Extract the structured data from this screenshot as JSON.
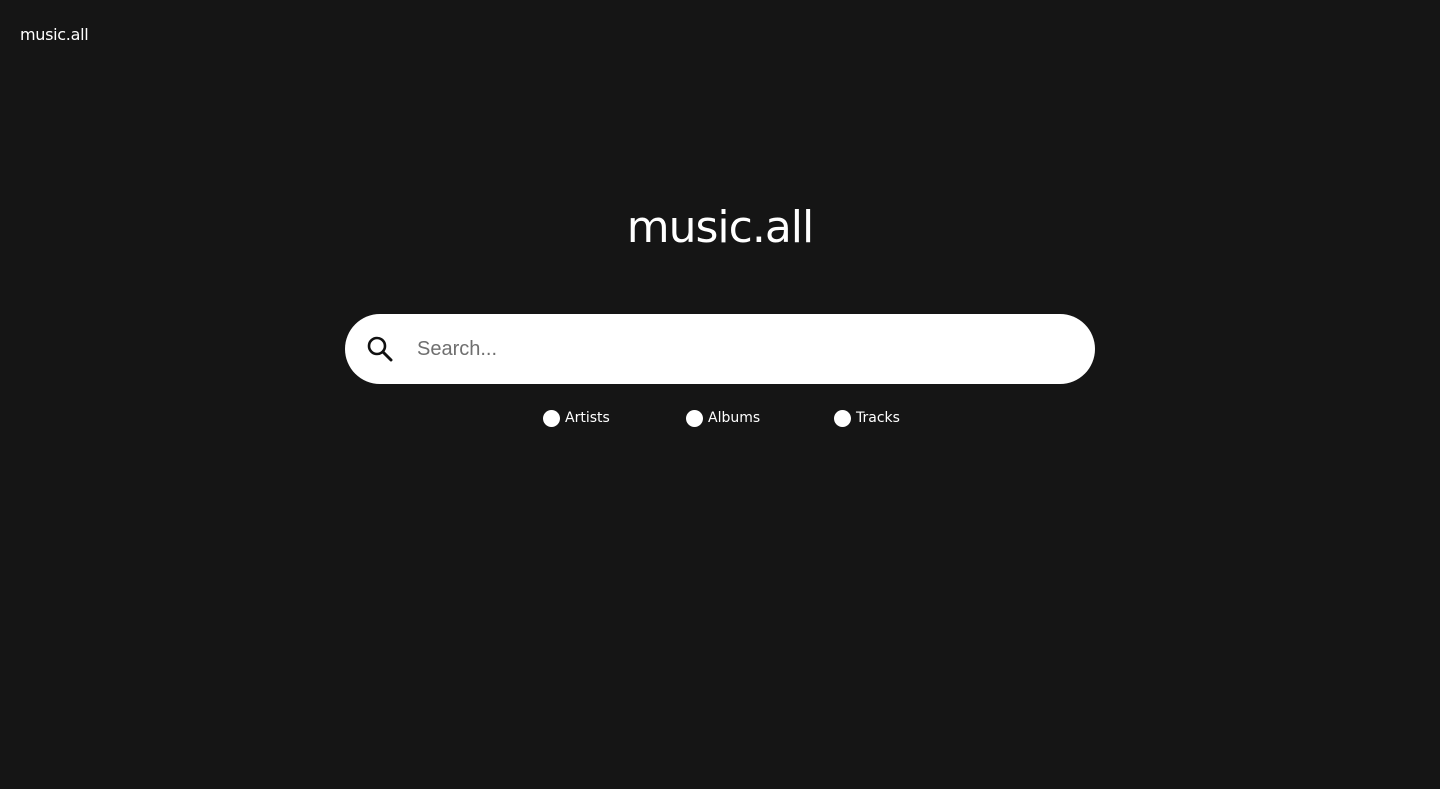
{
  "header": {
    "logo": "music.all"
  },
  "hero": {
    "logo": "music.all"
  },
  "search": {
    "value": "",
    "placeholder": "Search...",
    "icon": "search-icon"
  },
  "filters": [
    {
      "label": "Artists",
      "selected": false
    },
    {
      "label": "Albums",
      "selected": false
    },
    {
      "label": "Tracks",
      "selected": false
    }
  ],
  "colors": {
    "background": "#151515",
    "search_bar": "#ffffff",
    "text": "#ffffff",
    "radio": "#ffffff"
  }
}
